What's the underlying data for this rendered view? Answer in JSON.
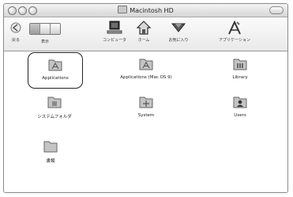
{
  "window": {
    "title": "Macintosh HD"
  },
  "toolbar": {
    "nav_label": "戻る",
    "view_label": "表示",
    "buttons": [
      {
        "label": "コンピュータ",
        "icon": "computer-icon"
      },
      {
        "label": "ホーム",
        "icon": "home-icon"
      },
      {
        "label": "お気に入り",
        "icon": "favorites-icon"
      },
      {
        "label": "アプリケーション",
        "icon": "applications-icon"
      }
    ]
  },
  "items": [
    {
      "name": "Applications",
      "selected": true
    },
    {
      "name": "Applications (Mac OS 9)"
    },
    {
      "name": "Library"
    },
    {
      "name": "システムフォルダ"
    },
    {
      "name": "System"
    },
    {
      "name": "Users"
    },
    {
      "name": "書類"
    }
  ]
}
